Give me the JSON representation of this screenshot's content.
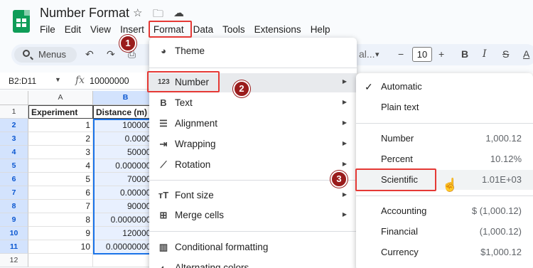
{
  "doc": {
    "title": "Number Format"
  },
  "menubar": [
    "File",
    "Edit",
    "View",
    "Insert",
    "Format",
    "Data",
    "Tools",
    "Extensions",
    "Help"
  ],
  "toolbar": {
    "search_label": "Menus",
    "undo_glyph": "↶",
    "redo_glyph": "↷",
    "font_frag": "al...",
    "dropdown_glyph": "▾",
    "minus_glyph": "−",
    "font_size": "10",
    "plus_glyph": "+",
    "bold": "B",
    "italic": "I",
    "strike": "S",
    "text_color": "A"
  },
  "formula_bar": {
    "name_box": "B2:D11",
    "fx": "fx",
    "value": "10000000"
  },
  "sheet": {
    "columns": [
      "A",
      "B"
    ],
    "rows": [
      "1",
      "2",
      "3",
      "4",
      "5",
      "6",
      "7",
      "8",
      "9",
      "10",
      "11",
      "12"
    ],
    "headers": [
      "Experiment",
      "Distance (m)"
    ],
    "data": [
      [
        "1",
        "1000000"
      ],
      [
        "2",
        "0.00000"
      ],
      [
        "3",
        "500000"
      ],
      [
        "4",
        "0.0000000"
      ],
      [
        "5",
        "700000"
      ],
      [
        "6",
        "0.000000"
      ],
      [
        "7",
        "900000"
      ],
      [
        "8",
        "0.00000000"
      ],
      [
        "9",
        "1200000"
      ],
      [
        "10",
        "0.000000000"
      ]
    ]
  },
  "format_menu": {
    "theme": "Theme",
    "number": "Number",
    "number_icon": "123",
    "text": "Text",
    "alignment": "Alignment",
    "wrapping": "Wrapping",
    "rotation": "Rotation",
    "font_size": "Font size",
    "merge_cells": "Merge cells",
    "conditional_formatting": "Conditional formatting",
    "alternating_colors": "Alternating colors",
    "arrow": "▶"
  },
  "number_submenu": {
    "check": "✓",
    "items": [
      {
        "label": "Automatic",
        "example": ""
      },
      {
        "label": "Plain text",
        "example": ""
      },
      {
        "label": "Number",
        "example": "1,000.12"
      },
      {
        "label": "Percent",
        "example": "10.12%"
      },
      {
        "label": "Scientific",
        "example": "1.01E+03"
      },
      {
        "label": "Accounting",
        "example": "$ (1,000.12)"
      },
      {
        "label": "Financial",
        "example": "(1,000.12)"
      },
      {
        "label": "Currency",
        "example": "$1,000.12"
      }
    ]
  },
  "annotations": {
    "step1": "1",
    "step2": "2",
    "step3": "3",
    "color": "#e53935"
  }
}
